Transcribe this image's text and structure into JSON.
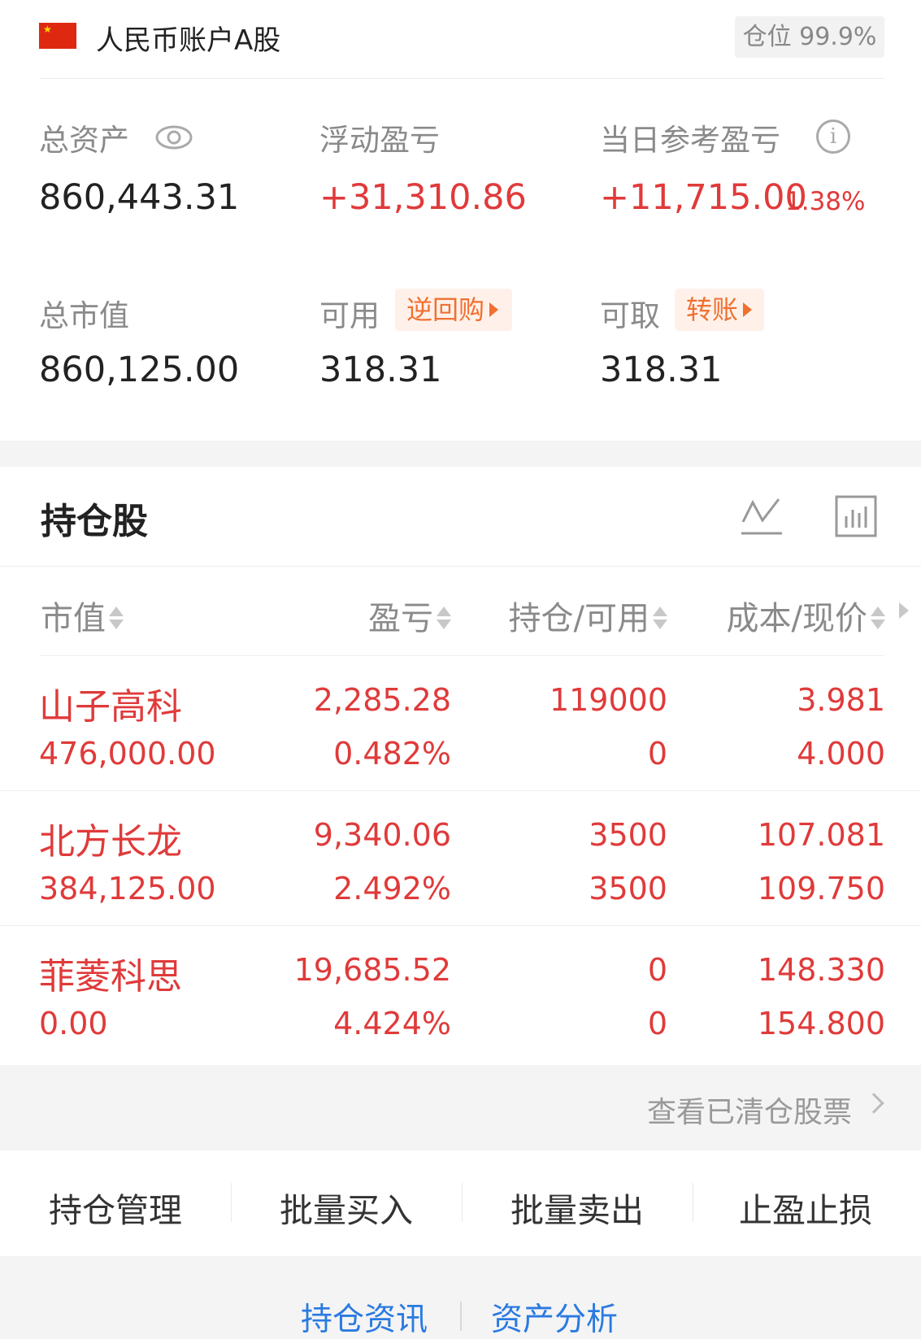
{
  "header": {
    "account_title": "人民币账户A股",
    "position_label": "仓位 99.9%"
  },
  "summary": {
    "total_assets": {
      "label": "总资产",
      "value": "860,443.31"
    },
    "floating_pl": {
      "label": "浮动盈亏",
      "value": "+31,310.86"
    },
    "daily_pl": {
      "label": "当日参考盈亏",
      "value": "+11,715.00",
      "pct": "1.38%"
    },
    "market_value": {
      "label": "总市值",
      "value": "860,125.00"
    },
    "available": {
      "label": "可用",
      "value": "318.31",
      "action": "逆回购"
    },
    "withdrawable": {
      "label": "可取",
      "value": "318.31",
      "action": "转账"
    }
  },
  "holdings": {
    "title": "持仓股",
    "columns": [
      "市值",
      "盈亏",
      "持仓/可用",
      "成本/现价"
    ],
    "rows": [
      {
        "name": "山子高科",
        "market_value": "476,000.00",
        "pl": "2,285.28",
        "pl_pct": "0.482%",
        "position": "119000",
        "available": "0",
        "cost": "3.981",
        "price": "4.000"
      },
      {
        "name": "北方长龙",
        "market_value": "384,125.00",
        "pl": "9,340.06",
        "pl_pct": "2.492%",
        "position": "3500",
        "available": "3500",
        "cost": "107.081",
        "price": "109.750"
      },
      {
        "name": "菲菱科思",
        "market_value": "0.00",
        "pl": "19,685.52",
        "pl_pct": "4.424%",
        "position": "0",
        "available": "0",
        "cost": "148.330",
        "price": "154.800"
      }
    ],
    "cleared_link": "查看已清仓股票"
  },
  "actions": [
    "持仓管理",
    "批量买入",
    "批量卖出",
    "止盈止损"
  ],
  "bottom_links": [
    "持仓资讯",
    "资产分析"
  ],
  "colors": {
    "red": "#e03a3a",
    "orange": "#f07030",
    "blue": "#2a7ae2",
    "gray": "#8a8a8a"
  },
  "icons": [
    "china-flag-icon",
    "eye-icon",
    "info-icon",
    "line-chart-icon",
    "bar-chart-icon",
    "sort-icon",
    "chevron-right-icon"
  ]
}
